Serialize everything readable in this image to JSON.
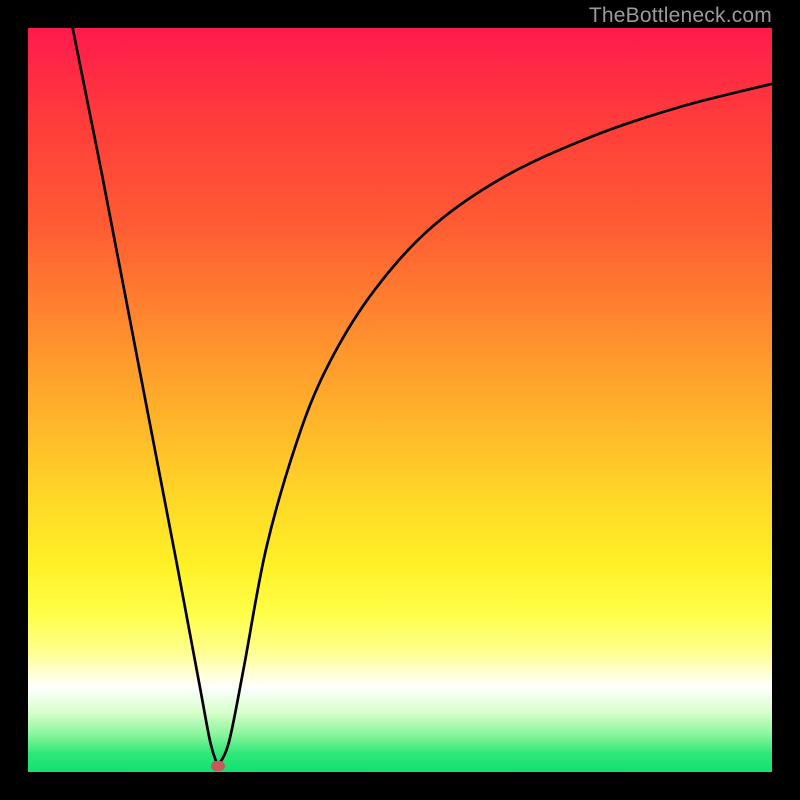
{
  "attribution": "TheBottleneck.com",
  "colors": {
    "frame": "#000000",
    "dot": "#c9575e",
    "curve": "#000000",
    "gradient_top": "#ff1a4d",
    "gradient_bottom": "#11e070"
  },
  "chart_data": {
    "type": "line",
    "title": "",
    "xlabel": "",
    "ylabel": "",
    "xlim": [
      0,
      100
    ],
    "ylim": [
      0,
      100
    ],
    "annotations": [
      {
        "type": "marker",
        "x": 25.5,
        "y": 0.8,
        "color": "#c9575e"
      }
    ],
    "series": [
      {
        "name": "left-branch",
        "x": [
          6,
          10,
          15,
          20,
          23,
          24.5
        ],
        "values": [
          100,
          80,
          54,
          28,
          12,
          4
        ]
      },
      {
        "name": "right-branch",
        "x": [
          25.5,
          27,
          29,
          32,
          36,
          40,
          46,
          54,
          64,
          76,
          88,
          100
        ],
        "values": [
          0.8,
          4,
          14,
          30,
          44,
          54,
          64,
          73,
          80,
          85.5,
          89.5,
          92.5
        ]
      }
    ]
  }
}
